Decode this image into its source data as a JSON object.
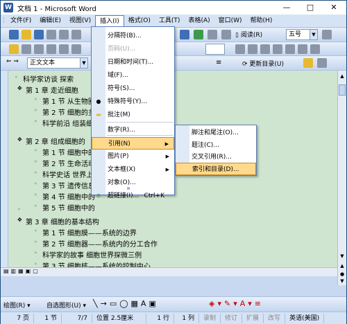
{
  "window": {
    "title": "文档 1 - Microsoft Word",
    "icon_letter": "W"
  },
  "window_controls": [
    "—",
    "□",
    "✕"
  ],
  "menubar": [
    "文件(F)",
    "编辑(E)",
    "视图(V)",
    "插入(I)",
    "格式(O)",
    "工具(T)",
    "表格(A)",
    "窗口(W)",
    "帮助(H)"
  ],
  "toolbar1": {
    "read_label": "阅读(R)",
    "font_size": "五号"
  },
  "toolbar3": {
    "style": "正文文本",
    "update_toc": "更新目录(U)"
  },
  "document_lines": [
    "科学家访谈  探索",
    "第 1 章  走近细胞",
    "第 1 节  从生物圈",
    "第 2 节  细胞的多",
    "科学前沿  组装细",
    "第 2 章  组成细胞的",
    "第 1 节  细胞中的",
    "第 2 节  生命活动",
    "科学史话  世界上",
    "第 3 节  遗传信息",
    "第 4 节  细胞中的",
    "第 5 节  细胞中的",
    "第 3 章  细胞的基本结构",
    "第 1 节  细胞膜——系统的边界",
    "第 2 节  细胞器——系统内的分工合作",
    "科学家的故事  细胞世界探微三例",
    "第 3 节  细胞核——系统的控制中心",
    "第 4 章  细胞的物质输入和输出",
    "第 1 节  物质跨膜运输的实例"
  ],
  "insert_menu": {
    "items": [
      {
        "label": "分隔符(B)...",
        "disabled": false,
        "icon": ""
      },
      {
        "label": "页码(U)...",
        "disabled": true,
        "icon": ""
      },
      {
        "label": "日期和时间(T)...",
        "disabled": false,
        "icon": ""
      },
      {
        "label": "域(F)...",
        "disabled": false,
        "icon": ""
      },
      {
        "label": "符号(S)...",
        "disabled": false,
        "icon": ""
      },
      {
        "label": "特殊符号(Y)...",
        "disabled": false,
        "icon": "●"
      },
      {
        "label": "批注(M)",
        "disabled": false,
        "icon": "comment-icon"
      },
      {
        "label": "数字(R)...",
        "disabled": false,
        "icon": ""
      },
      {
        "label": "引用(N)",
        "disabled": false,
        "icon": "",
        "submenu": true,
        "highlighted": true
      },
      {
        "label": "图片(P)",
        "disabled": false,
        "icon": "",
        "submenu": true
      },
      {
        "label": "文本框(X)",
        "disabled": false,
        "icon": "",
        "submenu": true
      },
      {
        "label": "对象(O)...",
        "disabled": false,
        "icon": ""
      },
      {
        "label": "超链接(I)...",
        "shortcut": "Ctrl+K",
        "disabled": false,
        "icon": "hyperlink-icon"
      }
    ],
    "expand": "»"
  },
  "reference_menu": {
    "items": [
      {
        "label": "脚注和尾注(O)..."
      },
      {
        "label": "题注(C)..."
      },
      {
        "label": "交叉引用(R)..."
      },
      {
        "label": "索引和目录(D)...",
        "highlighted": true
      }
    ]
  },
  "drawbar": {
    "draw": "绘图(R)",
    "autoshapes": "自选图形(U)"
  },
  "statusbar": [
    "7 页",
    "1 节",
    "7/7",
    "位置 2.5厘米",
    "1 行",
    "1 列",
    "录制",
    "修订",
    "扩展",
    "改写",
    "英语(美国)"
  ],
  "colors": {
    "doc_bg": "#d0e5d0",
    "menu_highlight": "#ffd98c",
    "chrome": "#d6e3f5"
  }
}
